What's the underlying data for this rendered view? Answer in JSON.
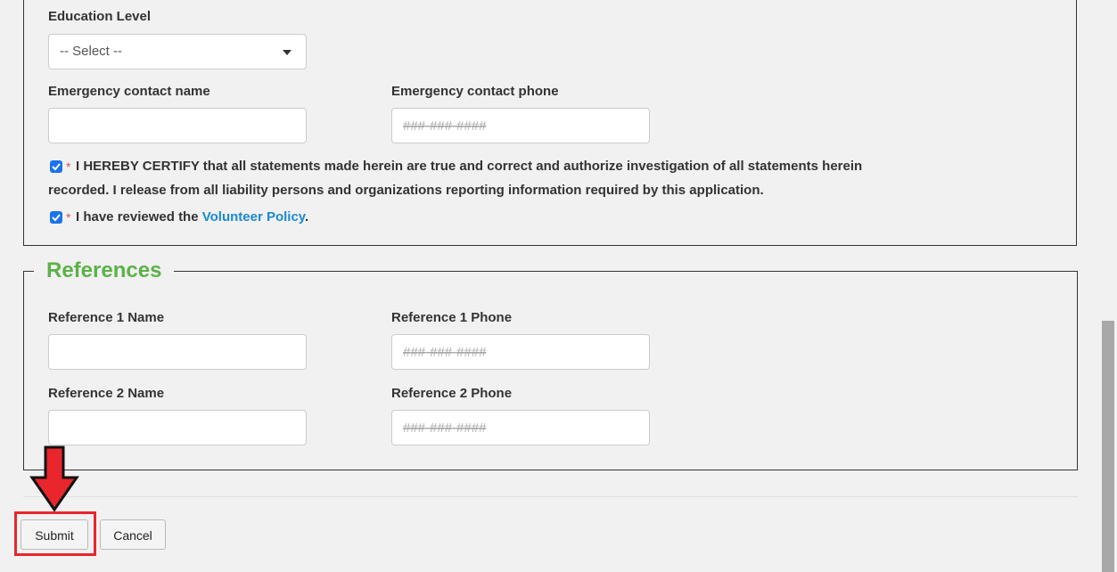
{
  "personal": {
    "education_label": "Education Level",
    "education_value": "-- Select --",
    "emergency_name_label": "Emergency contact name",
    "emergency_phone_label": "Emergency contact phone",
    "phone_placeholder": "###-###-####",
    "certify_text_1": "I HEREBY CERTIFY that all statements made herein are true and correct and authorize investigation of all statements herein",
    "certify_text_2": "recorded. I release from all liability persons and organizations reporting information required by this application.",
    "policy_text": "I have reviewed the ",
    "policy_link": "Volunteer Policy",
    "policy_period": ".",
    "required_mark": "*"
  },
  "references": {
    "legend": "References",
    "ref1_name_label": "Reference 1 Name",
    "ref1_phone_label": "Reference 1 Phone",
    "ref2_name_label": "Reference 2 Name",
    "ref2_phone_label": "Reference 2 Phone",
    "phone_placeholder": "###-###-####"
  },
  "actions": {
    "submit_label": "Submit",
    "cancel_label": "Cancel"
  },
  "colors": {
    "legend_green": "#5cb248",
    "link_blue": "#1a8ad4",
    "highlight_red": "#e8262b",
    "checkbox_blue": "#1a73e8"
  },
  "annotations": {
    "arrow_icon": "down-arrow-icon"
  }
}
